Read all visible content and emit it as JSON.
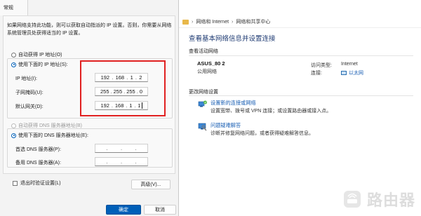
{
  "dialog": {
    "tab_label": "常规",
    "description": "如果网络支持此功能，则可以获取自动指派的 IP 设置。否则，你需要从网络系统管理员处获得适当的 IP 设置。",
    "auto_ip_label": "自动获得 IP 地址(O)",
    "manual_ip_label": "使用下面的 IP 地址(S):",
    "ip_label": "IP 地址(I):",
    "ip_value": [
      "192",
      "168",
      "1",
      "2"
    ],
    "subnet_label": "子网掩码(U):",
    "subnet_value": [
      "255",
      "255",
      "255",
      "0"
    ],
    "gateway_label": "默认网关(D):",
    "gateway_value": [
      "192",
      "168",
      "1",
      "1"
    ],
    "auto_dns_label": "自动获得 DNS 服务器地址(B)",
    "manual_dns_label": "使用下面的 DNS 服务器地址(E):",
    "preferred_dns_label": "首选 DNS 服务器(P):",
    "alternate_dns_label": "备用 DNS 服务器(A):",
    "validate_label": "退出时验证设置(L)",
    "advanced_button": "高级(V)...",
    "ok_button": "确定",
    "cancel_button": "取消"
  },
  "network_center": {
    "breadcrumb": [
      "网络和 Internet",
      "网络和共享中心"
    ],
    "page_title": "查看基本网络信息并设置连接",
    "active_networks_label": "查看活动网络",
    "network_name": "ASUS_80 2",
    "network_type": "公用网络",
    "access_type_label": "访问类型:",
    "access_type_value": "Internet",
    "connections_label": "连接:",
    "connection_value": "以太网",
    "change_settings_label": "更改网络设置",
    "tasks": [
      {
        "title": "设置新的连接或网络",
        "desc": "设置宽带、拨号或 VPN 连接；或设置路由器或接入点。",
        "icon": "network-setup-icon"
      },
      {
        "title": "问题疑难解答",
        "desc": "诊断并修复网络问题，或者获得疑难解答信息。",
        "icon": "troubleshoot-icon"
      }
    ]
  },
  "watermark": {
    "text": "路由器"
  },
  "colors": {
    "accent": "#005fb8",
    "highlight": "#e02020",
    "link": "#1a5fb4",
    "title": "#1f3b73"
  }
}
